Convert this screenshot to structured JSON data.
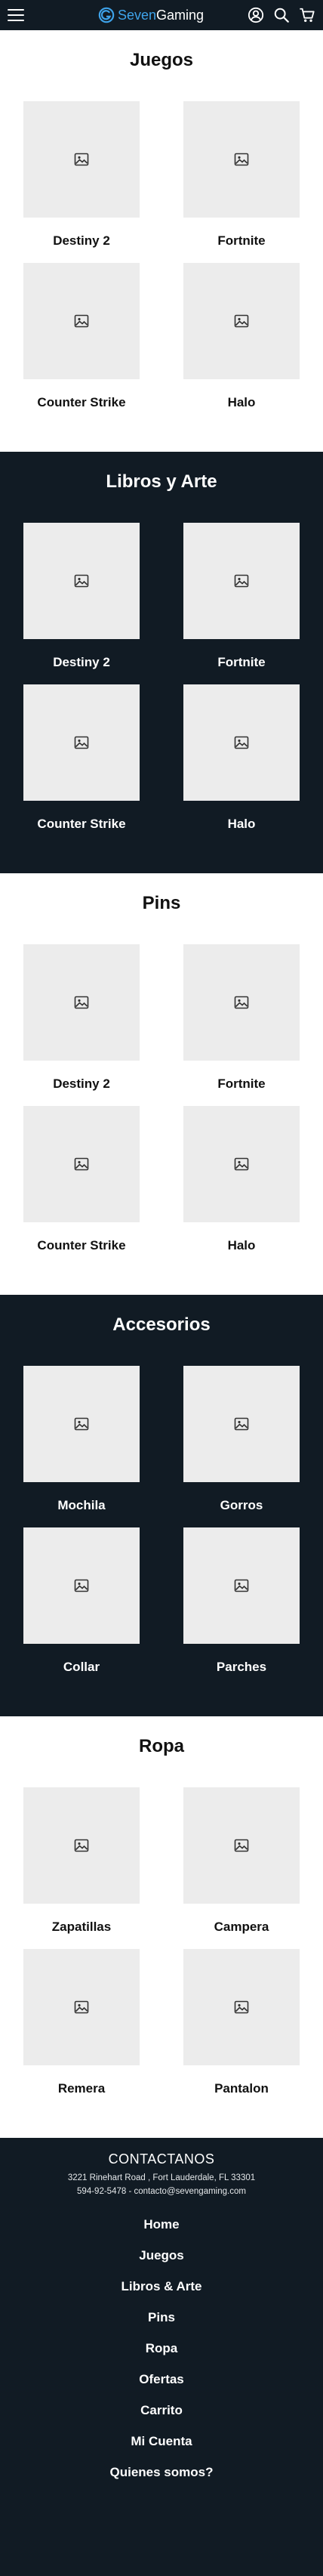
{
  "header": {
    "logo": {
      "part1": "Seven",
      "part2": "Gaming"
    },
    "icons": [
      "menu-icon",
      "user-icon",
      "search-icon",
      "cart-icon"
    ]
  },
  "sections": [
    {
      "id": "juegos",
      "title": "Juegos",
      "theme": "light",
      "items": [
        "Destiny 2",
        "Fortnite",
        "Counter Strike",
        "Halo"
      ]
    },
    {
      "id": "libros-arte",
      "title": "Libros y Arte",
      "theme": "dark",
      "items": [
        "Destiny 2",
        "Fortnite",
        "Counter Strike",
        "Halo"
      ]
    },
    {
      "id": "pins",
      "title": "Pins",
      "theme": "light",
      "items": [
        "Destiny 2",
        "Fortnite",
        "Counter Strike",
        "Halo"
      ]
    },
    {
      "id": "accesorios",
      "title": "Accesorios",
      "theme": "dark",
      "items": [
        "Mochila",
        "Gorros",
        "Collar",
        "Parches"
      ]
    },
    {
      "id": "ropa",
      "title": "Ropa",
      "theme": "light",
      "items": [
        "Zapatillas",
        "Campera",
        "Remera",
        "Pantalon"
      ]
    }
  ],
  "footer": {
    "title": "CONTACTANOS",
    "address": "3221 Rinehart Road , Fort Lauderdale, FL 33301",
    "contact": "594-92-5478  - contacto@sevengaming.com",
    "nav": [
      "Home",
      "Juegos",
      "Libros & Arte",
      "Pins",
      "Ropa",
      "Ofertas",
      "Carrito",
      "Mi Cuenta",
      "Quienes somos?"
    ]
  },
  "colors": {
    "dark_bg": "#111b24",
    "accent": "#3ea3ea",
    "placeholder": "#ececec"
  }
}
